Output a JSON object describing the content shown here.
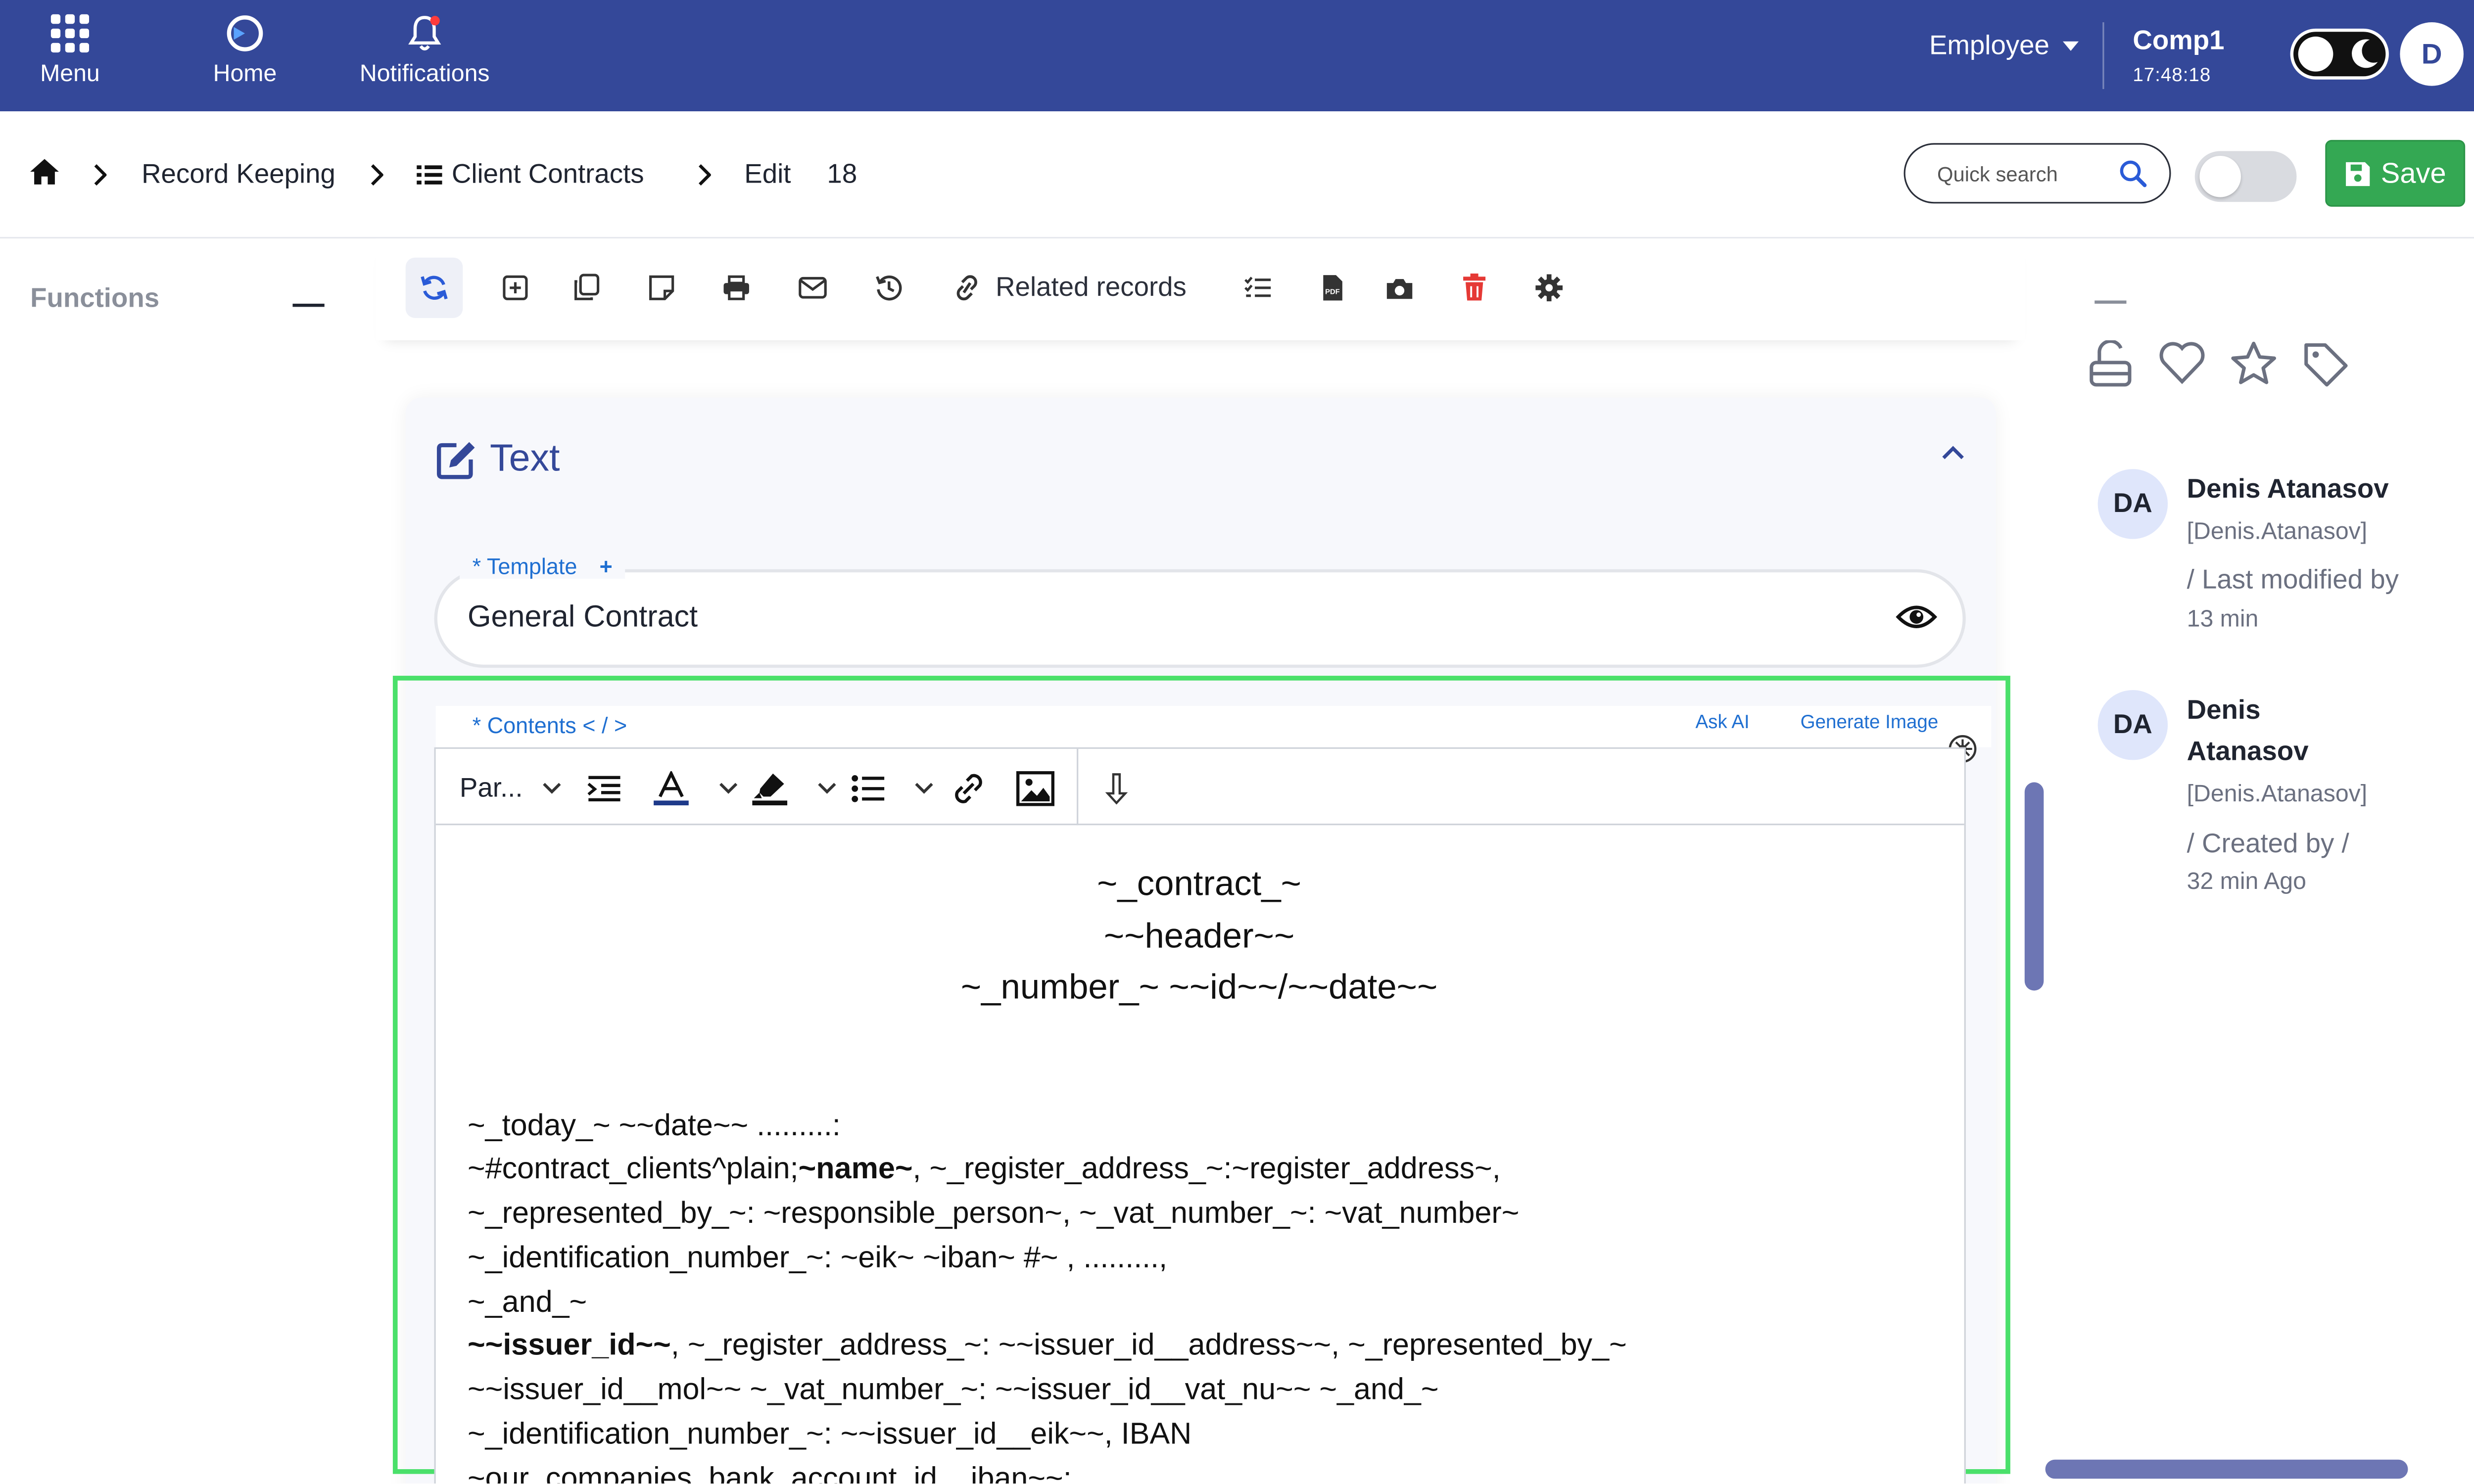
{
  "topnav": {
    "menu_label": "Menu",
    "home_label": "Home",
    "notifications_label": "Notifications",
    "role": "Employee",
    "company": "Comp1",
    "time": "17:48:18",
    "user_initial": "D"
  },
  "breadcrumb": {
    "record_keeping": "Record Keeping",
    "client_contracts": "Client Contracts",
    "edit": "Edit",
    "record_id": "18"
  },
  "search": {
    "placeholder": "Quick search"
  },
  "save_label": "Save",
  "functions": {
    "title": "Functions"
  },
  "toolbar": {
    "related_records": "Related records"
  },
  "card": {
    "title": "Text",
    "template_label": "* Template",
    "template_plus": "+",
    "template_value": "General Contract",
    "contents_label": "* Contents < / >",
    "ask_ai": "Ask AI",
    "generate_image": "Generate Image",
    "paragraph_style": "Par..."
  },
  "document": {
    "line1": "~_contract_~",
    "line2": "~~header~~",
    "line3": "~_number_~ ~~id~~/~~date~~",
    "p1": "~_today_~ ~~date~~ .........:",
    "p2a": "~#contract_clients^plain;",
    "p2b": "~name~",
    "p2c": ", ~_register_address_~:~register_address~,",
    "p3": "~_represented_by_~: ~responsible_person~, ~_vat_number_~: ~vat_number~",
    "p4": "~_identification_number_~: ~eik~ ~iban~ #~ , .........,",
    "p5": "~_and_~",
    "p6a": "~~issuer_id~~",
    "p6b": ", ~_register_address_~: ~~issuer_id__address~~,  ~_represented_by_~",
    "p7": "~~issuer_id__mol~~ ~_vat_number_~: ~~issuer_id__vat_nu~~ ~_and_~",
    "p8": "~_identification_number_~: ~~issuer_id__eik~~, IBAN",
    "p9": "~our_companies_bank_account_id__iban~~;"
  },
  "activity": [
    {
      "initials": "DA",
      "name": "Denis Atanasov",
      "username": "[Denis.Atanasov]",
      "action": "/ Last modified by",
      "time": "13 min"
    },
    {
      "initials": "DA",
      "name_line1": "Denis",
      "name_line2": "Atanasov",
      "username": "[Denis.Atanasov]",
      "action": "/ Created by /",
      "time": "32 min Ago"
    }
  ],
  "colors": {
    "nav_bg": "#344899",
    "save_green": "#34a853",
    "link_blue": "#1f6fd1",
    "highlight_frame": "#4ae06a",
    "delete_red": "#e53935"
  }
}
